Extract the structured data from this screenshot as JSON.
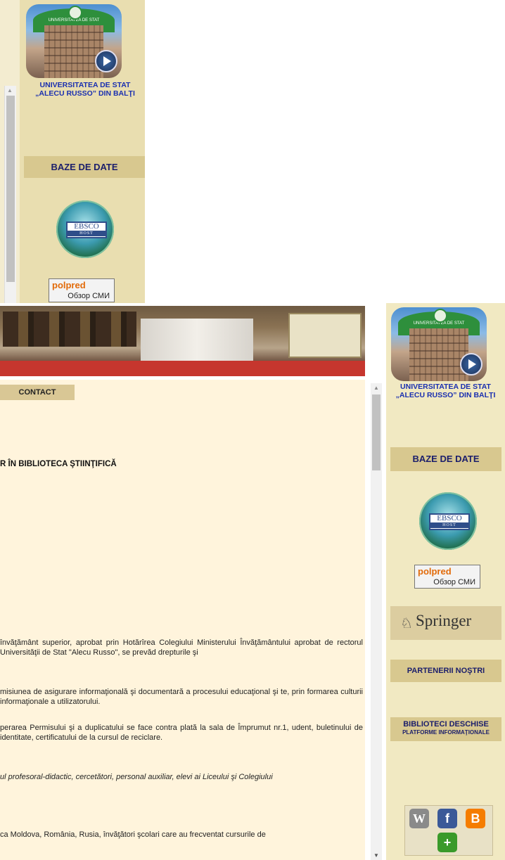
{
  "sidebar": {
    "university_line1": "UNIVERSITATEA DE STAT",
    "university_line2": "„ALECU RUSSO” DIN BALŢI",
    "logo_arch_text": "UNIVERSITATEA DE STAT",
    "databases_heading": "BAZE DE DATE",
    "ebsco_label": "EBSCO",
    "ebsco_sub": "HOST",
    "polpred_brand": "polpred",
    "polpred_sub": "Обзор СМИ",
    "springer_label": "Springer",
    "partners": "PARTENERII NOŞTRI",
    "open_libraries": "BIBLIOTECI DESCHISE",
    "platforms": "PLATFORME INFORMAŢIONALE"
  },
  "nav": {
    "contact": "CONTACT"
  },
  "main": {
    "heading": "R ÎN BIBLIOTECA ŞTIINŢIFICĂ",
    "paragraphs": [
      "învăţământ superior, aprobat prin Hotărîrea Colegiului Ministerului Învăţământului aprobat de rectorul Universităţii de Stat \"Alecu Russo\", se prevăd drepturile şi",
      "misiunea de asigurare informaţională şi documentară a procesului educaţional şi te, prin formarea culturii informaţionale a utilizatorului.",
      "perarea Permisului şi a duplicatului se face contra plată la sala de Împrumut nr.1, udent, buletinului de identitate, certificatului de la cursul de reciclare.",
      "ul profesoral-didactic, cercetători, personal auxiliar, elevi ai Liceului şi Colegiului",
      "ca Moldova, România, Rusia, învăţători şcolari care au frecventat cursurile de"
    ]
  },
  "social": {
    "wiki": "W",
    "facebook": "f",
    "blogger": "B",
    "add": "+"
  },
  "colors": {
    "sidebar_bg": "#f1e9c2",
    "heading_bg": "#d8c88f",
    "heading_text": "#1b1e6b",
    "university_text": "#1a2fb0",
    "content_bg": "#fff4dc"
  }
}
